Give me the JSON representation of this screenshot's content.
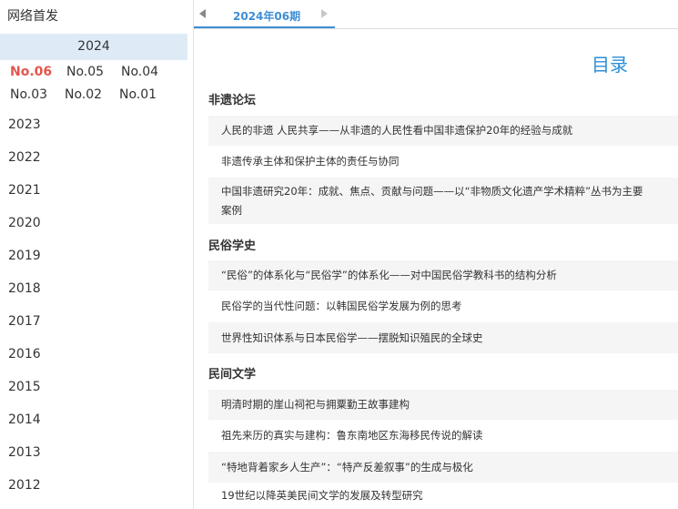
{
  "sidebar": {
    "title": "网络首发",
    "current_year": "2024",
    "issues": [
      "No.06",
      "No.05",
      "No.04",
      "No.03",
      "No.02",
      "No.01"
    ],
    "active_issue": "No.06",
    "years": [
      "2023",
      "2022",
      "2021",
      "2020",
      "2019",
      "2018",
      "2017",
      "2016",
      "2015",
      "2014",
      "2013",
      "2012"
    ]
  },
  "tabbar": {
    "current_tab": "2024年06期",
    "prev_icon": "arrow-left-icon",
    "next_icon": "arrow-right-icon"
  },
  "toc": {
    "title": "目录",
    "sections": [
      {
        "heading": "非遗论坛",
        "articles": [
          "人民的非遗 人民共享——从非遗的人民性看中国非遗保护20年的经验与成就",
          "非遗传承主体和保护主体的责任与协同",
          "中国非遗研究20年：成就、焦点、贡献与问题——以“非物质文化遗产学术精粹”丛书为主要案例"
        ]
      },
      {
        "heading": "民俗学史",
        "articles": [
          "“民俗”的体系化与“民俗学”的体系化——对中国民俗学教科书的结构分析",
          "民俗学的当代性问题：以韩国民俗学发展为例的思考",
          "世界性知识体系与日本民俗学——摆脱知识殖民的全球史"
        ]
      },
      {
        "heading": "民间文学",
        "articles": [
          "明清时期的崖山祠祀与拥粟勤王故事建构",
          "祖先来历的真实与建构：鲁东南地区东海移民传说的解读",
          "“特地背着家乡人生产”：“特产反差叙事”的生成与极化",
          "19世纪以降英美民间文学的发展及转型研究"
        ]
      }
    ]
  },
  "colors": {
    "accent_blue": "#3f8ed4",
    "active_red": "#e4554c",
    "year_highlight": "#deebf7",
    "row_gray": "#f5f5f5"
  }
}
